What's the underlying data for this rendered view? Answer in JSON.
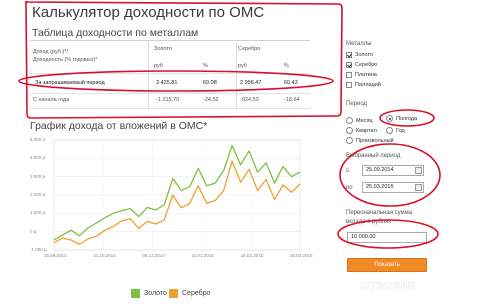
{
  "title": "Калькулятор доходности по ОМС",
  "table": {
    "title": "Таблица доходности по металлам",
    "header": {
      "row_label_1": "Доход (руб.)*/",
      "row_label_2": "Доходность (% годовых)*",
      "gold": "Золото",
      "silver": "Серебро",
      "unit_rub_1": "руб",
      "unit_pct_1": "%",
      "unit_rub_2": "руб",
      "unit_pct_2": "%"
    },
    "rows": [
      {
        "label": "За запрашиваемый период",
        "gold_rub": "3 425.81",
        "gold_pct": "69.08",
        "silver_rub": "2 996.47",
        "silver_pct": "60.43"
      },
      {
        "label": "С начала года",
        "gold_rub": "-1 215.70",
        "gold_pct": "-24.52",
        "silver_rub": "-924.50",
        "silver_pct": "-18.64"
      }
    ]
  },
  "chart_title": "График дохода от вложений в ОМС*",
  "chart_data": {
    "type": "line",
    "x": [
      "25.09.2014",
      "31.10.2014",
      "06.12.2014",
      "11.01.2015",
      "16.02.2015",
      "25.03.2015"
    ],
    "y_ticks": [
      "5 000 р.",
      "4 000 р.",
      "3 000 р.",
      "2 000 р.",
      "1 000 р.",
      "0 р.",
      "-1 000 р."
    ],
    "ylim": [
      -1000,
      5000
    ],
    "series": [
      {
        "name": "Золото",
        "color": "#7dc142",
        "values": [
          -450,
          -180,
          80,
          -220,
          200,
          480,
          760,
          1000,
          1150,
          1260,
          820,
          1320,
          1180,
          1480,
          2900,
          2250,
          2450,
          3450,
          2500,
          2650,
          3350,
          4700,
          3650,
          4400,
          3250,
          3750,
          2650,
          3550,
          3000,
          3250
        ]
      },
      {
        "name": "Серебро",
        "color": "#f0a030",
        "values": [
          -600,
          -350,
          -450,
          -700,
          -400,
          -250,
          80,
          280,
          600,
          700,
          180,
          560,
          420,
          650,
          2000,
          1300,
          1550,
          2500,
          1550,
          1700,
          2250,
          3850,
          2700,
          3400,
          2250,
          2850,
          1750,
          2550,
          2150,
          2600
        ]
      }
    ]
  },
  "legend": {
    "gold": "Золото",
    "silver": "Серебро"
  },
  "side": {
    "metals_label": "Металлы",
    "metals": [
      {
        "label": "Золото",
        "checked": true
      },
      {
        "label": "Серебро",
        "checked": true
      },
      {
        "label": "Платина",
        "checked": false
      },
      {
        "label": "Палладий",
        "checked": false
      }
    ],
    "period_label": "Период",
    "period_month": "Месяц",
    "period_halfyear": "Полгода",
    "period_quarter": "Квартал",
    "period_year": "Год",
    "period_custom": "Произвольный",
    "selected_period_label": "Выбранный период",
    "from_label": "с",
    "to_label": "по",
    "date_from": "25.09.2014",
    "date_to": "25.03.2015",
    "sum_label_1": "Первоначальная сумма",
    "sum_label_2": "вклада в рублях",
    "sum_value": "10 000.00",
    "show_button": "Показать"
  },
  "watermark": "ОТЗОВИК",
  "colors": {
    "highlight": "#d8102a",
    "gold": "#7dc142",
    "silver": "#f0a030",
    "button": "#f08a24"
  }
}
